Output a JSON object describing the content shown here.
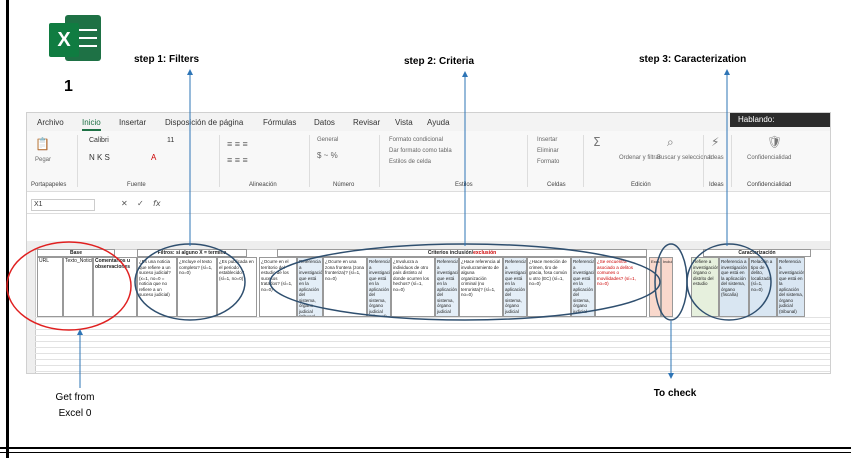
{
  "logo": {
    "letter": "X",
    "number": "1"
  },
  "steps": {
    "filters": "step 1: Filters",
    "criteria": "step 2: Criteria",
    "caracterization": "step 3: Caracterization"
  },
  "notes": {
    "get_from_line1": "Get from",
    "get_from_line2": "Excel 0",
    "to_check": "To check"
  },
  "excel": {
    "tabs": [
      "Archivo",
      "Inicio",
      "Insertar",
      "Disposición de página",
      "Fórmulas",
      "Datos",
      "Revisar",
      "Vista",
      "Ayuda"
    ],
    "active_tab": "Inicio",
    "speaking": "Hablando:",
    "font": {
      "name": "Calibri",
      "size": "11"
    },
    "format": "General",
    "ribbon_groups": [
      "Portapapeles",
      "Fuente",
      "Alineación",
      "Número",
      "Estilos",
      "Celdas",
      "Edición",
      "Ideas",
      "Confidencialidad"
    ],
    "ribbon_items": {
      "paste": "Pegar",
      "cond_format": "Formato condicional",
      "table_format": "Dar formato como tabla",
      "cell_styles": "Estilos de celda",
      "insert": "Insertar",
      "delete": "Eliminar",
      "format": "Formato",
      "sort": "Ordenar y filtrar",
      "find": "Buscar y seleccionar",
      "ideas": "Ideas",
      "conf": "Confidencialidad"
    },
    "name_box": "X1",
    "sheet": {
      "headers": {
        "base": "Base",
        "filters": "Filtros: si alguno X = termina",
        "criteria_black": "Criterios inclusión/",
        "criteria_red": "exclusión",
        "caracterization": "Caracterización"
      },
      "base_cols": [
        "URL",
        "Texto_Noticia",
        "Comentarios u observaciones"
      ],
      "filter_cols": [
        "¿Es una noticia que refiere a un suceso judicial? (x=1, no=0 = noticia que no refiere a un suceso judicial)",
        "¿Incluye el texto completo? (sí=1, no=0)",
        "¿Es publicada en el periodo establecido? (sí=1, no=0)"
      ],
      "criteria_cols": [
        "¿Ocurre en el territorio del estudio de los sucesos tratados? (sí=1, no=0)",
        "Referencia a investigación que está en la aplicación del sistema, órgano judicial (tribunal, fiscalía)",
        "¿Ocurre en una zona frontera (zona fronteriza)? (sí=1, no=0)",
        "Referencia a investigación que está en la aplicación del sistema, órgano judicial (tribunal)",
        "¿Involucra a individuos de otro país distinto al donde ocurren los hechos? (sí=1, no=0)",
        "Referencia a investigación que está en la aplicación del sistema, órgano judicial",
        "¿Hace referencia al involucramiento de alguna organización criminal (no terrorista)? (sí=1, no=0)",
        "Referencia a investigación que está en la aplicación del sistema, órgano judicial",
        "¿Hace mención de crimen, tiro de gracia, fosa común u otro (EC) (sí=1, no=0)",
        "Referencia a investigación que está en la aplicación del sistema, órgano judicial",
        "¿Se encuentra asociado a delitos comunes o movilidades? (sí=1, no=0)"
      ],
      "check_cols": [
        "Excluido",
        "Incluido"
      ],
      "car_cols": [
        "Refiere a investigación, órgano o distrito del estudio",
        "Referencia a investigación que está en la aplicación del sistema, órgano (fiscalía)",
        "Relación a tipo de delito, localizada (sí=1, no=0)",
        "Referencia a investigación que está en la aplicación del sistema, órgano judicial (tribunal)"
      ]
    }
  }
}
